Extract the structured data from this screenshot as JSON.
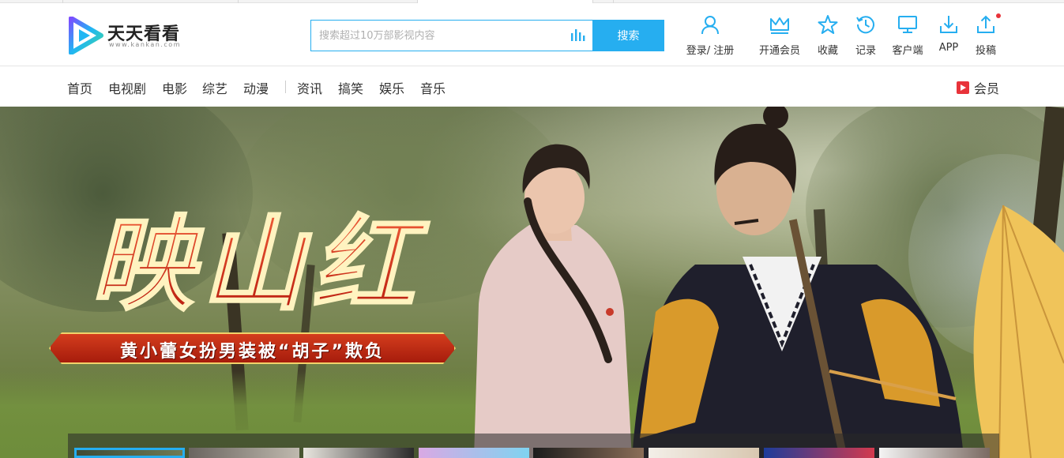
{
  "brand": {
    "name": "天天看看",
    "domain": "www.kankan.com"
  },
  "search": {
    "placeholder": "搜索超过10万部影视内容",
    "button_label": "搜索"
  },
  "actions": [
    {
      "label": "登录/ 注册",
      "icon": "user-icon"
    },
    {
      "label": "开通会员",
      "icon": "crown-icon"
    },
    {
      "label": "收藏",
      "icon": "star-icon"
    },
    {
      "label": "记录",
      "icon": "history-icon"
    },
    {
      "label": "客户端",
      "icon": "monitor-icon"
    },
    {
      "label": "APP",
      "icon": "download-icon"
    },
    {
      "label": "投稿",
      "icon": "upload-icon"
    }
  ],
  "nav": {
    "items": [
      "首页",
      "电视剧",
      "电影",
      "综艺",
      "动漫",
      "资讯",
      "搞笑",
      "娱乐",
      "音乐"
    ],
    "vip_label": "会员"
  },
  "banner": {
    "title": "映山红",
    "subtitle": "黄小蕾女扮男装被“胡子”欺负"
  },
  "colors": {
    "accent": "#26aef0",
    "vip_red": "#e8333a",
    "title_red": "#d9321a"
  }
}
